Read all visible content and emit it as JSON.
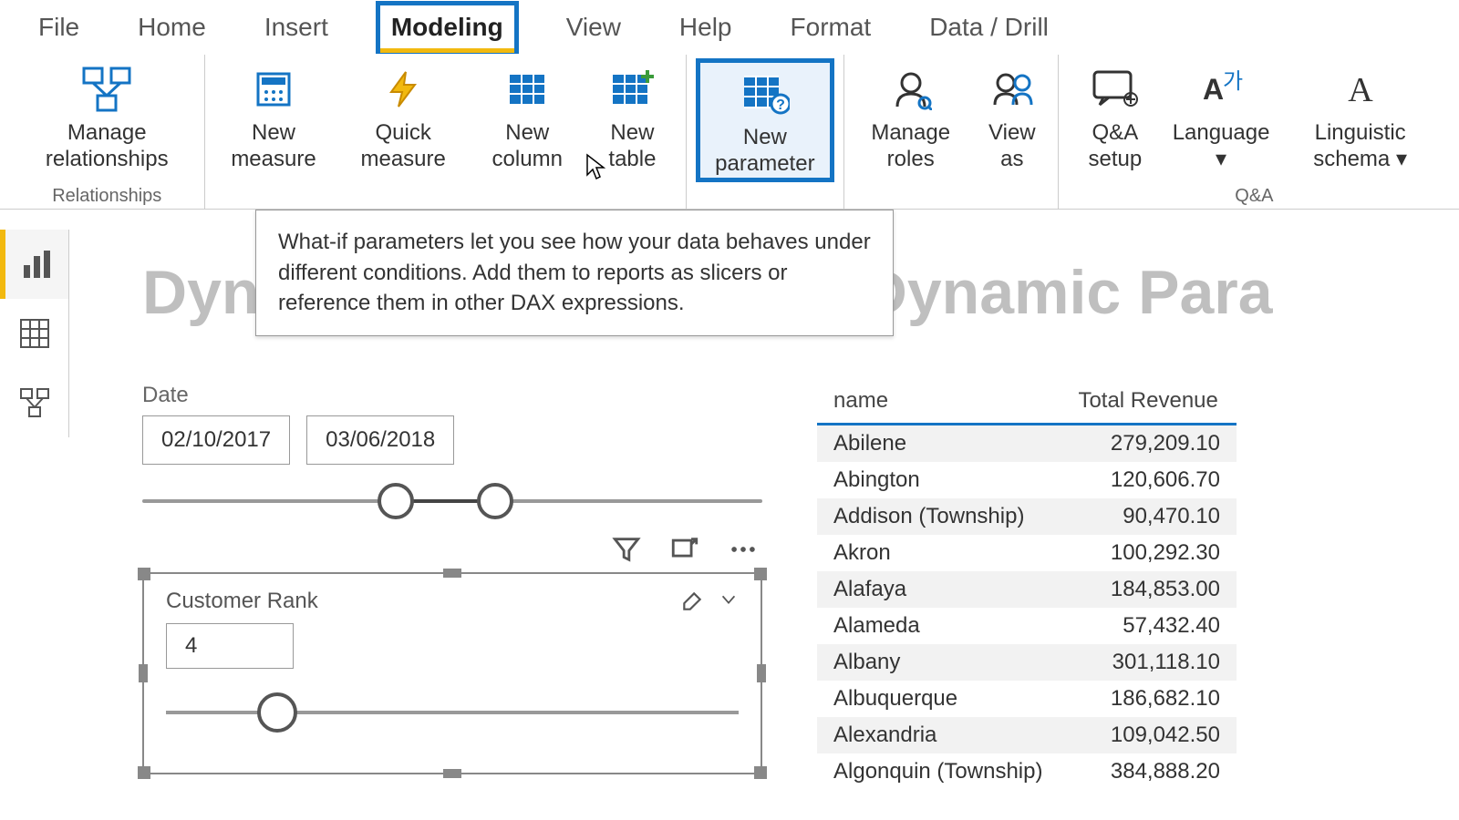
{
  "ribbon": {
    "tabs": [
      "File",
      "Home",
      "Insert",
      "Modeling",
      "View",
      "Help",
      "Format",
      "Data / Drill"
    ],
    "active_tab": "Modeling",
    "groups": {
      "relationships": {
        "label": "Relationships",
        "buttons": [
          "Manage relationships"
        ]
      },
      "calculations": {
        "buttons": [
          "New measure",
          "Quick measure",
          "New column",
          "New table"
        ]
      },
      "whatif": {
        "buttons": [
          "New parameter"
        ]
      },
      "security": {
        "buttons": [
          "Manage roles",
          "View as"
        ]
      },
      "qna": {
        "label": "Q&A",
        "buttons": [
          "Q&A setup",
          "Language",
          "Linguistic schema"
        ]
      }
    }
  },
  "tooltip": "What-if parameters let you see how your data behaves under different conditions. Add them to reports as slicers or reference them in other DAX expressions.",
  "page": {
    "title": "Dynamic Segmentation, Dynamic Para"
  },
  "date_slicer": {
    "label": "Date",
    "from": "02/10/2017",
    "to": "03/06/2018"
  },
  "customer_rank": {
    "title": "Customer Rank",
    "value": "4"
  },
  "table": {
    "columns": [
      "name",
      "Total Revenue"
    ],
    "rows": [
      {
        "name": "Abilene",
        "value": "279,209.10"
      },
      {
        "name": "Abington",
        "value": "120,606.70"
      },
      {
        "name": "Addison (Township)",
        "value": "90,470.10"
      },
      {
        "name": "Akron",
        "value": "100,292.30"
      },
      {
        "name": "Alafaya",
        "value": "184,853.00"
      },
      {
        "name": "Alameda",
        "value": "57,432.40"
      },
      {
        "name": "Albany",
        "value": "301,118.10"
      },
      {
        "name": "Albuquerque",
        "value": "186,682.10"
      },
      {
        "name": "Alexandria",
        "value": "109,042.50"
      },
      {
        "name": "Algonquin (Township)",
        "value": "384,888.20"
      }
    ]
  }
}
